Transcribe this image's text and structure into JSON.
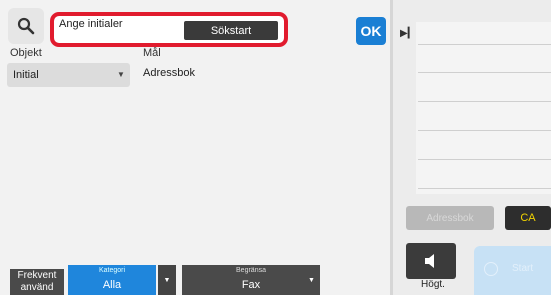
{
  "search": {
    "label": "Ange initialer",
    "start_button": "Sökstart",
    "ok_button": "OK"
  },
  "columns": {
    "objekt": "Objekt",
    "mal": "Mål"
  },
  "row": {
    "selected": "Initial",
    "value": "Adressbok"
  },
  "bottom": {
    "frekvent": "Frekvent använd",
    "kategori_label": "Kategori",
    "kategori_value": "Alla",
    "begransa_label": "Begränsa",
    "begransa_value": "Fax"
  },
  "right": {
    "disabled_button": "Adressbok",
    "ca_button": "CA",
    "volume_label": "Högt.",
    "start_button": "Start"
  },
  "colors": {
    "accent_blue": "#1a7fd4",
    "highlight_red": "#e11b2e",
    "ca_yellow": "#f2d400"
  }
}
